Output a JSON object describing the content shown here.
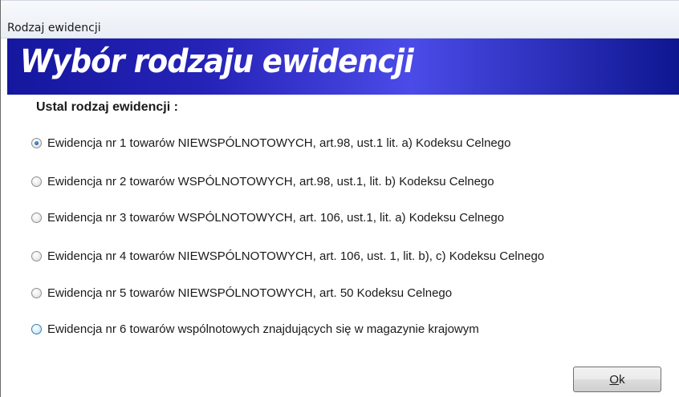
{
  "window": {
    "title": "Rodzaj ewidencji"
  },
  "banner": {
    "heading": "Wybór rodzaju ewidencji"
  },
  "group": {
    "label": "Ustal rodzaj ewidencji :",
    "options": [
      {
        "label": "Ewidencja nr 1 towarów NIEWSPÓLNOTOWYCH, art.98, ust.1 lit. a) Kodeksu Celnego",
        "checked": true
      },
      {
        "label": "Ewidencja nr 2 towarów WSPÓLNOTOWYCH, art.98, ust.1, lit. b) Kodeksu Celnego",
        "checked": false
      },
      {
        "label": "Ewidencja nr 3 towarów WSPÓLNOTOWYCH, art. 106, ust.1, lit. a) Kodeksu Celnego",
        "checked": false
      },
      {
        "label": "Ewidencja nr 4 towarów NIEWSPÓLNOTOWYCH, art. 106, ust. 1, lit. b), c) Kodeksu Celnego",
        "checked": false
      },
      {
        "label": "Ewidencja nr 5 towarów NIEWSPÓLNOTOWYCH, art. 50 Kodeksu Celnego",
        "checked": false
      },
      {
        "label": "Ewidencja nr 6 towarów wspólnotowych znajdujących się w magazynie krajowym",
        "checked": false
      }
    ]
  },
  "buttons": {
    "ok_mnemonic": "O",
    "ok_rest": "k"
  },
  "colors": {
    "banner_dark": "#15179e",
    "banner_light": "#4b4be8",
    "radio_selected": "#1d5fa8"
  }
}
